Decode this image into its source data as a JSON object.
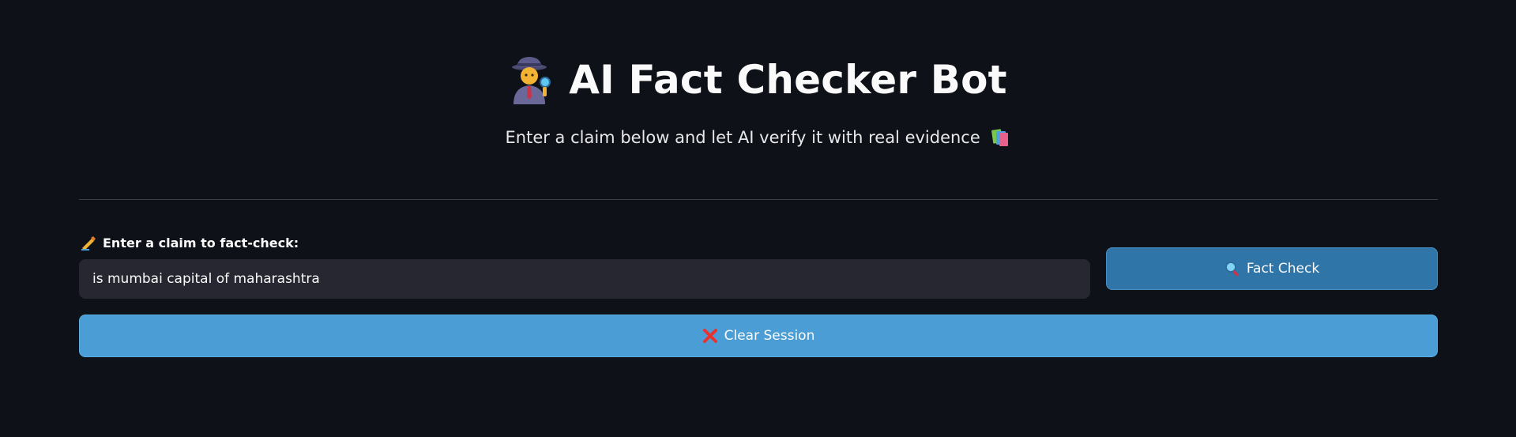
{
  "header": {
    "title": "AI Fact Checker Bot",
    "title_icon": "detective-icon",
    "subtitle": "Enter a claim below and let AI verify it with real evidence",
    "subtitle_icon": "books-icon"
  },
  "form": {
    "label": "Enter a claim to fact-check:",
    "label_icon": "writing-hand-icon",
    "claim_value": "is mumbai capital of maharashtra",
    "fact_check_label": "Fact Check",
    "fact_check_icon": "magnifier-icon",
    "clear_label": "Clear Session",
    "clear_icon": "cross-mark-icon"
  },
  "colors": {
    "background": "#0e1117",
    "input_background": "#262730",
    "fact_check_button": "#3075a8",
    "clear_button": "#4a9ed5",
    "clear_icon": "#e8322f"
  }
}
